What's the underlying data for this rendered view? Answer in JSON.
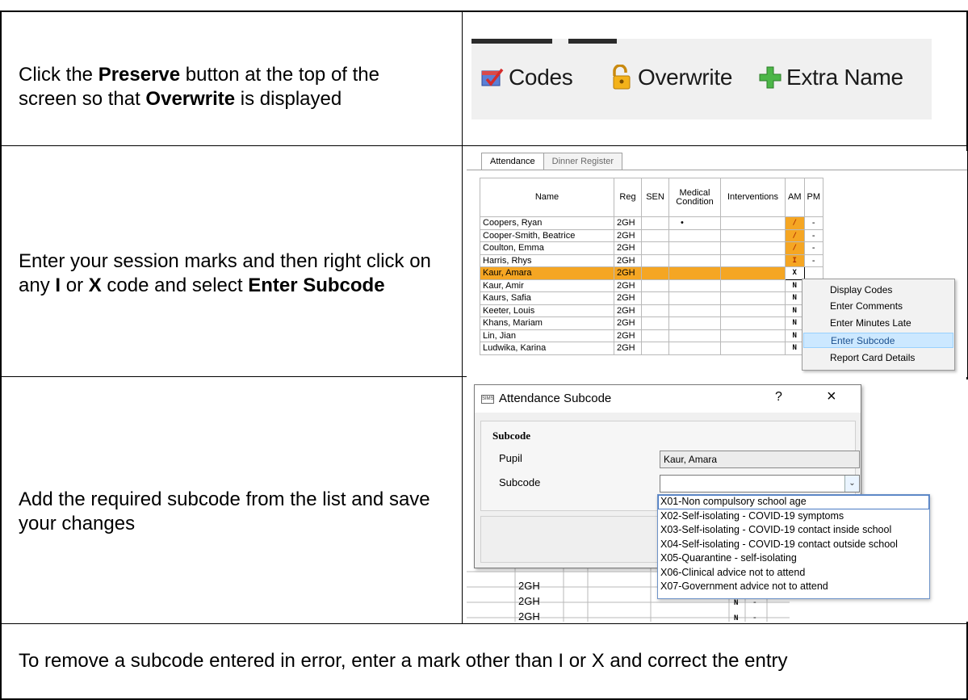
{
  "rows": {
    "r1": {
      "pre": "Click the ",
      "b1": "Preserve",
      "mid": " button at the top of the screen so that ",
      "b2": "Overwrite",
      "post": " is displayed"
    },
    "r2": {
      "pre": "Enter your session marks and then right click on any ",
      "b1": "I",
      "mid1": " or ",
      "b2": "X",
      "mid2": " code and select ",
      "b3": "Enter Subcode"
    },
    "r3": {
      "text": "Add the required subcode from the list and save your changes"
    },
    "r4": {
      "text": "To remove a subcode entered in error, enter a mark other than I or X and correct the entry"
    }
  },
  "toolbar": {
    "codes_label": "Codes",
    "overwrite_label": "Overwrite",
    "extra_name_label": "Extra Name"
  },
  "register": {
    "tabs": [
      "Attendance",
      "Dinner Register"
    ],
    "headers": [
      "Name",
      "Reg",
      "SEN",
      "Medical Condition",
      "Interventions",
      "AM",
      "PM"
    ],
    "students": [
      {
        "name": "Coopers, Ryan",
        "reg": "2GH",
        "medical": "•",
        "am": "/",
        "pm": "-"
      },
      {
        "name": "Cooper-Smith, Beatrice",
        "reg": "2GH",
        "medical": "",
        "am": "/",
        "pm": "-"
      },
      {
        "name": "Coulton, Emma",
        "reg": "2GH",
        "medical": "",
        "am": "/",
        "pm": "-"
      },
      {
        "name": "Harris, Rhys",
        "reg": "2GH",
        "medical": "",
        "am": "I",
        "pm": "-"
      },
      {
        "name": "Kaur, Amara",
        "reg": "2GH",
        "medical": "",
        "am": "X",
        "pm": ""
      },
      {
        "name": "Kaur, Amir",
        "reg": "2GH",
        "medical": "",
        "am": "N",
        "pm": ""
      },
      {
        "name": "Kaurs, Safia",
        "reg": "2GH",
        "medical": "",
        "am": "N",
        "pm": ""
      },
      {
        "name": "Keeter, Louis",
        "reg": "2GH",
        "medical": "",
        "am": "N",
        "pm": ""
      },
      {
        "name": "Khans, Mariam",
        "reg": "2GH",
        "medical": "",
        "am": "N",
        "pm": ""
      },
      {
        "name": "Lin, Jian",
        "reg": "2GH",
        "medical": "",
        "am": "N",
        "pm": ""
      },
      {
        "name": "Ludwika, Karina",
        "reg": "2GH",
        "medical": "",
        "am": "N",
        "pm": "-"
      }
    ],
    "context_menu": [
      "Display Codes",
      "Enter Comments",
      "Enter Minutes Late",
      "Enter Subcode",
      "Report Card Details"
    ]
  },
  "dialog": {
    "sims_badge": "SIMS",
    "title": "Attendance Subcode",
    "help": "?",
    "close": "×",
    "group_title": "Subcode",
    "pupil_label": "Pupil",
    "pupil_value": "Kaur, Amara",
    "subcode_label": "Subcode",
    "subcode_value": "",
    "options": [
      "X01-Non compulsory school age",
      "X02-Self-isolating - COVID-19 symptoms",
      "X03-Self-isolating - COVID-19 contact inside school",
      "X04-Self-isolating - COVID-19 contact outside school",
      "X05-Quarantine - self-isolating",
      "X06-Clinical advice not to attend",
      "X07-Government advice not to attend"
    ],
    "background_reg": [
      "2GH",
      "2GH",
      "2GH"
    ],
    "background_am": [
      "N",
      "N",
      "N"
    ],
    "background_pm": [
      "-",
      "-",
      "-"
    ]
  },
  "colors": {
    "highlight": "#f5a623",
    "menu_highlight": "#cce8ff",
    "border": "#000000"
  }
}
